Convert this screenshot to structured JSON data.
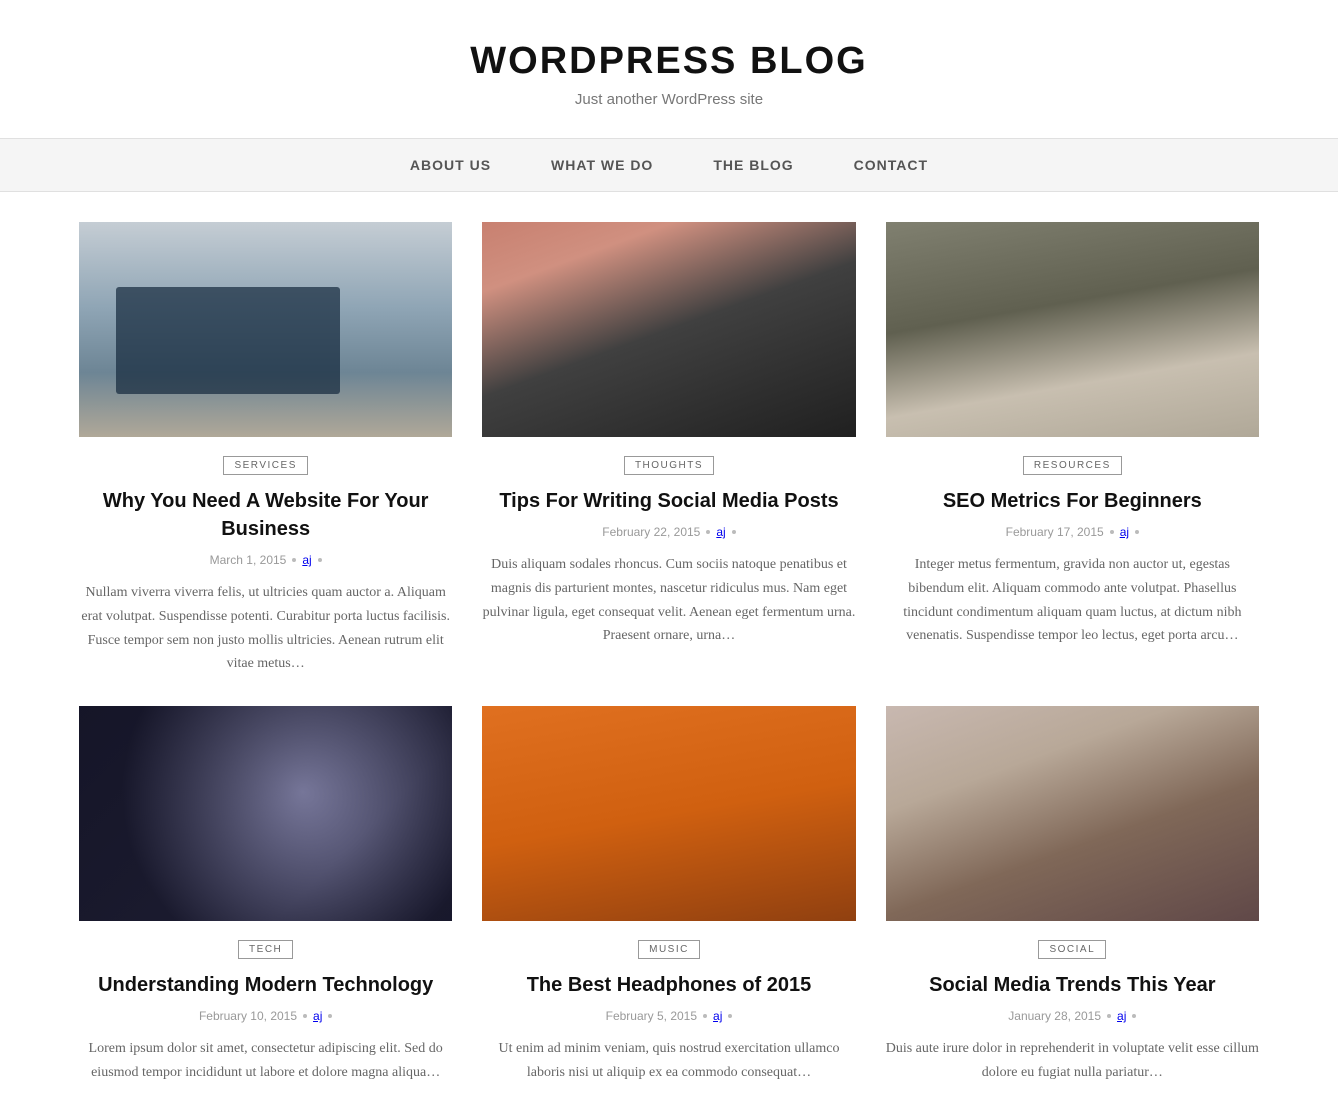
{
  "site": {
    "title": "WORDPRESS BLOG",
    "tagline": "Just another WordPress site"
  },
  "nav": {
    "items": [
      {
        "label": "ABOUT US",
        "href": "#"
      },
      {
        "label": "WHAT WE DO",
        "href": "#"
      },
      {
        "label": "THE BLOG",
        "href": "#"
      },
      {
        "label": "CONTACT",
        "href": "#"
      }
    ]
  },
  "posts": [
    {
      "category": "SERVICES",
      "title": "Why You Need A Website For Your Business",
      "date": "March 1, 2015",
      "author": "aj",
      "excerpt": "Nullam viverra viverra felis, ut ultricies quam auctor a. Aliquam erat volutpat. Suspendisse potenti. Curabitur porta luctus facilisis. Fusce tempor sem non justo mollis ultricies. Aenean rutrum elit vitae metus…",
      "thumb_class": "thumb-desk"
    },
    {
      "category": "THOUGHTS",
      "title": "Tips For Writing Social Media Posts",
      "date": "February 22, 2015",
      "author": "aj",
      "excerpt": "Duis aliquam sodales rhoncus. Cum sociis natoque penatibus et magnis dis parturient montes, nascetur ridiculus mus. Nam eget pulvinar ligula, eget consequat velit. Aenean eget fermentum urna. Praesent ornare, urna…",
      "thumb_class": "thumb-laptop"
    },
    {
      "category": "RESOURCES",
      "title": "SEO Metrics For Beginners",
      "date": "February 17, 2015",
      "author": "aj",
      "excerpt": "Integer metus fermentum, gravida non auctor ut, egestas bibendum elit. Aliquam commodo ante volutpat. Phasellus tincidunt condimentum aliquam quam luctus, at dictum nibh venenatis. Suspendisse tempor leo lectus, eget porta arcu…",
      "thumb_class": "thumb-phone"
    },
    {
      "category": "TECH",
      "title": "Understanding Modern Technology",
      "date": "February 10, 2015",
      "author": "aj",
      "excerpt": "Lorem ipsum dolor sit amet, consectetur adipiscing elit. Sed do eiusmod tempor incididunt ut labore et dolore magna aliqua…",
      "thumb_class": "thumb-blur"
    },
    {
      "category": "MUSIC",
      "title": "The Best Headphones of 2015",
      "date": "February 5, 2015",
      "author": "aj",
      "excerpt": "Ut enim ad minim veniam, quis nostrud exercitation ullamco laboris nisi ut aliquip ex ea commodo consequat…",
      "thumb_class": "thumb-headphones"
    },
    {
      "category": "SOCIAL",
      "title": "Social Media Trends This Year",
      "date": "January 28, 2015",
      "author": "aj",
      "excerpt": "Duis aute irure dolor in reprehenderit in voluptate velit esse cillum dolore eu fugiat nulla pariatur…",
      "thumb_class": "thumb-hands"
    }
  ]
}
